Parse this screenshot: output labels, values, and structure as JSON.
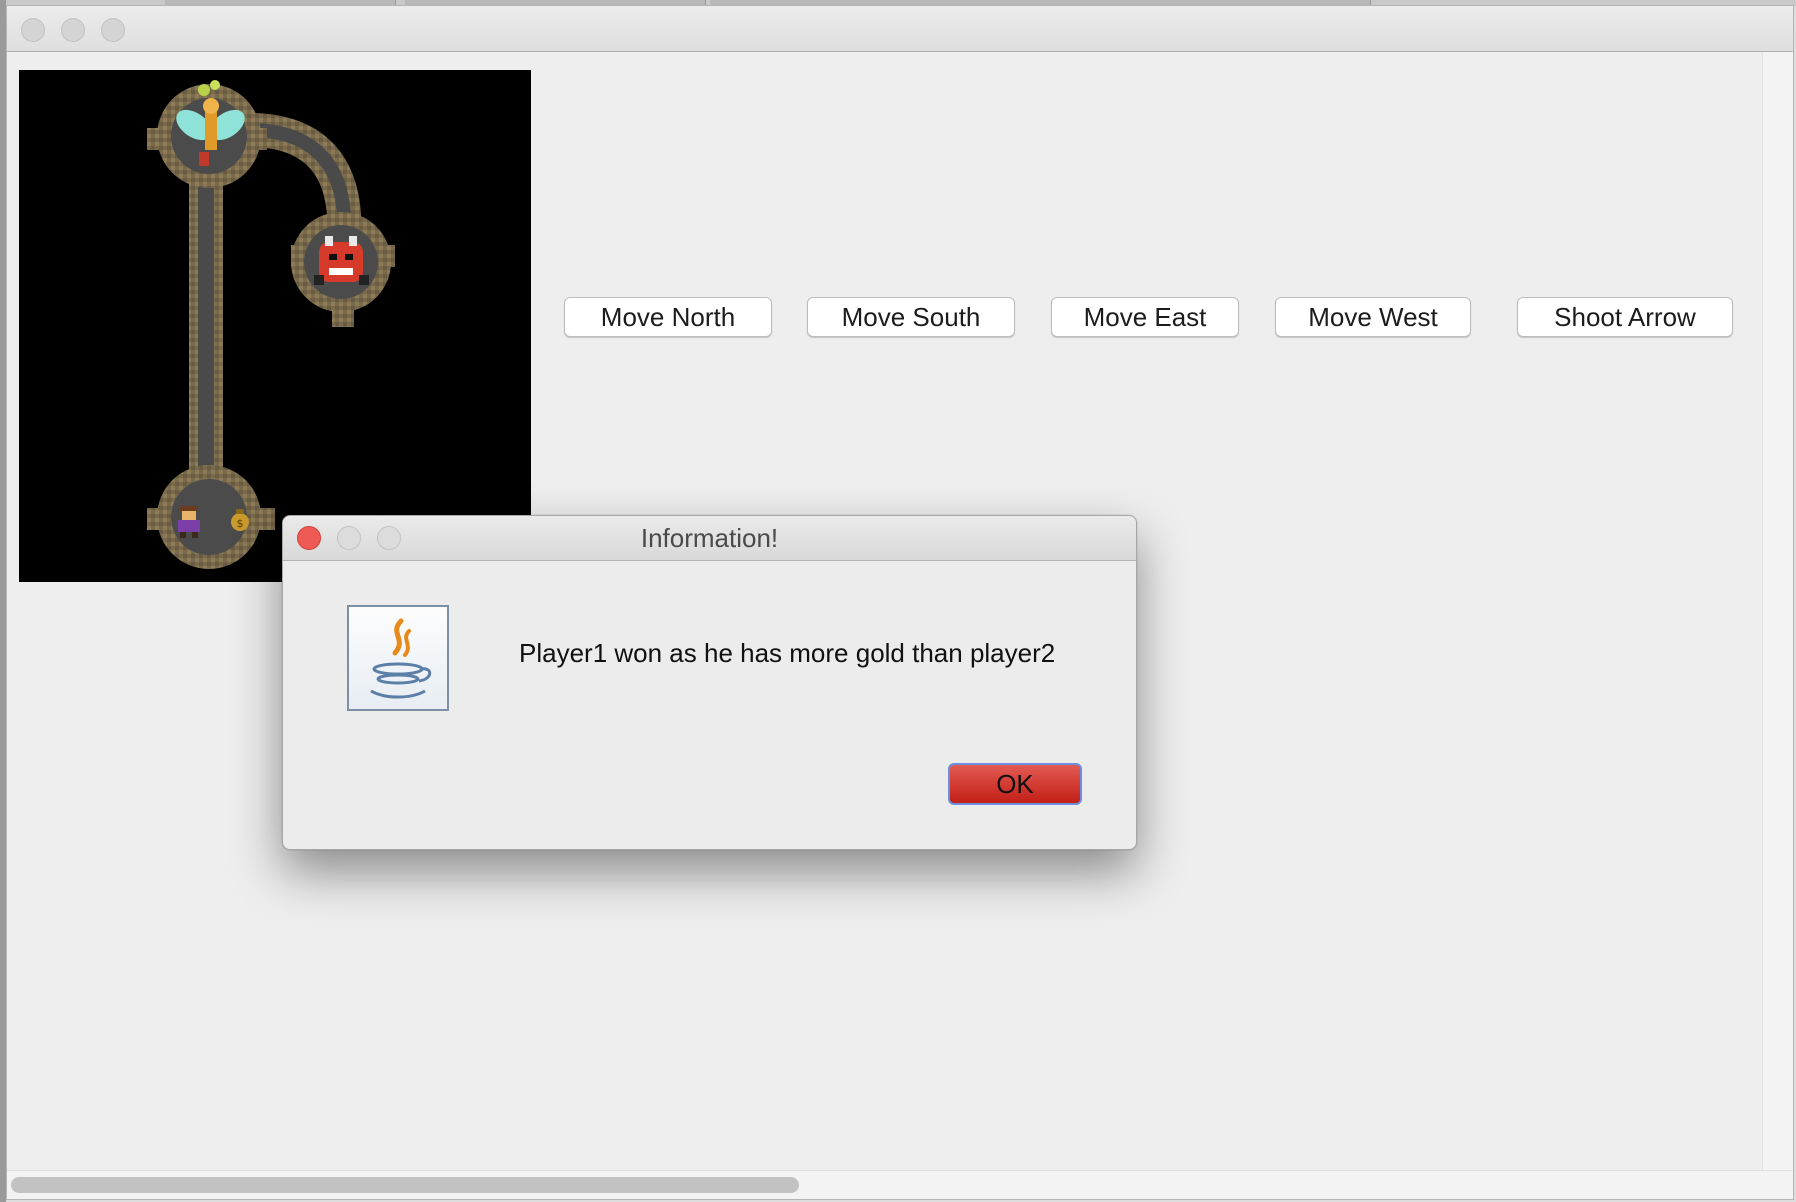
{
  "main_window": {
    "title": ""
  },
  "controls": {
    "move_north": "Move North",
    "move_south": "Move South",
    "move_east": "Move East",
    "move_west": "Move West",
    "shoot_arrow": "Shoot Arrow"
  },
  "dialog": {
    "title": "Information!",
    "message": "Player1 won as he has more gold than player2",
    "ok_label": "OK",
    "icon": "java-coffee-cup-icon"
  },
  "map": {
    "sprites": [
      "bat-icon",
      "wumpus-icon",
      "player-icon",
      "gold-bag-icon"
    ]
  },
  "colors": {
    "dialog_ok": "#c8241c",
    "map_background": "#000000",
    "close_button": "#ee5b54"
  }
}
